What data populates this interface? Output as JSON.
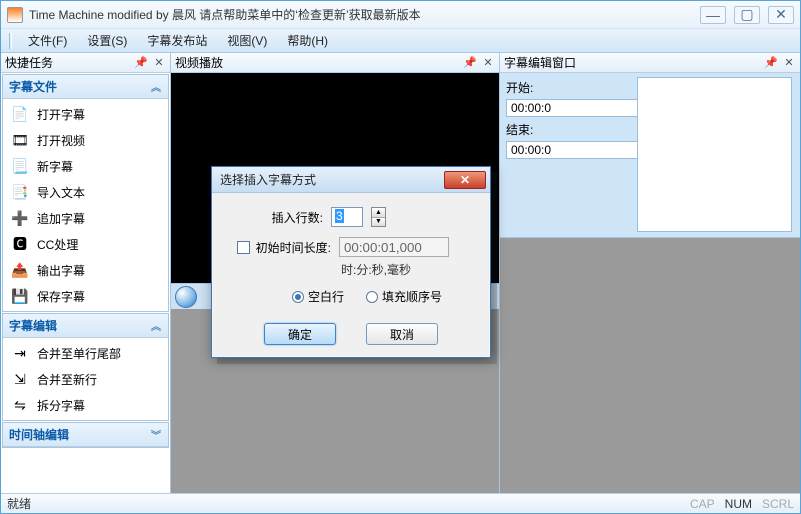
{
  "window": {
    "title": "Time Machine modified by 晨风 请点帮助菜单中的‘检查更新’获取最新版本"
  },
  "menu": {
    "file": "文件(F)",
    "settings": "设置(S)",
    "publish": "字幕发布站",
    "view": "视图(V)",
    "help": "帮助(H)"
  },
  "pane_titles": {
    "tasks": "快捷任务",
    "video": "视频播放",
    "editor": "字幕编辑窗口"
  },
  "sections": {
    "subtitle_file": {
      "title": "字幕文件",
      "items": [
        {
          "label": "打开字幕",
          "icon": "📄"
        },
        {
          "label": "打开视频",
          "icon": "🎞"
        },
        {
          "label": "新字幕",
          "icon": "📃"
        },
        {
          "label": "导入文本",
          "icon": "📑"
        },
        {
          "label": "追加字幕",
          "icon": "➕"
        },
        {
          "label": "CC处理",
          "icon": "🅲"
        },
        {
          "label": "输出字幕",
          "icon": "📤"
        },
        {
          "label": "保存字幕",
          "icon": "💾"
        }
      ]
    },
    "subtitle_edit": {
      "title": "字幕编辑",
      "items": [
        {
          "label": "合并至单行尾部",
          "icon": "⇥"
        },
        {
          "label": "合并至新行",
          "icon": "⇲"
        },
        {
          "label": "拆分字幕",
          "icon": "⇋"
        }
      ]
    },
    "timeline_edit": {
      "title": "时间轴编辑"
    }
  },
  "editor": {
    "start_label": "开始:",
    "start_value": "00:00:0",
    "end_label": "结束:",
    "end_value": "00:00:0"
  },
  "dialog": {
    "title": "选择插入字幕方式",
    "rows_label": "插入行数:",
    "rows_value": "3",
    "init_len_label": "初始时间长度:",
    "init_len_value": "00:00:01,000",
    "format_hint": "时:分:秒,毫秒",
    "opt_blank": "空白行",
    "opt_fill": "填充顺序号",
    "ok": "确定",
    "cancel": "取消"
  },
  "status": {
    "ready": "就绪",
    "cap": "CAP",
    "num": "NUM",
    "scrl": "SCRL"
  }
}
